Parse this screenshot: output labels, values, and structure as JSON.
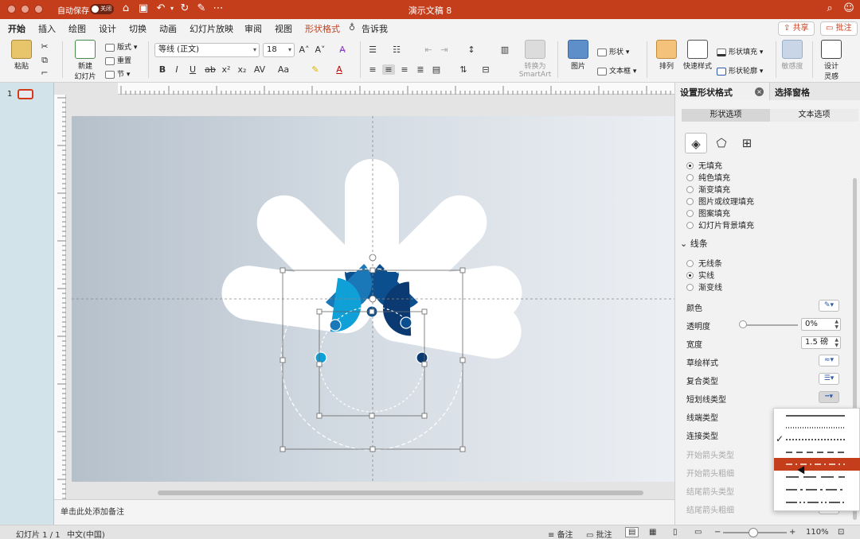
{
  "window": {
    "title": "演示文稿 8",
    "autosave_label": "自动保存",
    "autosave_state": "关闭"
  },
  "tabs": [
    "开始",
    "插入",
    "绘图",
    "设计",
    "切换",
    "动画",
    "幻灯片放映",
    "审阅",
    "视图",
    "形状格式",
    "告诉我"
  ],
  "active_tab": "开始",
  "top_buttons": {
    "share": "共享",
    "comment": "批注"
  },
  "ribbon": {
    "paste": "粘贴",
    "new_slide_line1": "新建",
    "new_slide_line2": "幻灯片",
    "layout": "版式",
    "reset": "重置",
    "section": "节",
    "font_name": "等线 (正文)",
    "font_size": "18",
    "convert_line1": "转换为",
    "convert_line2": "SmartArt",
    "picture": "图片",
    "shapes": "形状",
    "textbox": "文本框",
    "arrange": "排列",
    "quick_styles": "快速样式",
    "shape_fill": "形状填充",
    "shape_outline": "形状轮廓",
    "sensitivity": "敏感度",
    "designer_line1": "设计",
    "designer_line2": "灵感"
  },
  "slide_panel": {
    "number": "1"
  },
  "notes_placeholder": "单击此处添加备注",
  "status": {
    "slide": "幻灯片 1 / 1",
    "language": "中文(中国)",
    "notes": "备注",
    "comments": "批注",
    "zoom_level": "110%",
    "zoom_fraction": 0.45
  },
  "pane": {
    "title": "设置形状格式",
    "other_tab": "选择窗格",
    "subtab_shape": "形状选项",
    "subtab_text": "文本选项",
    "fill_options": [
      {
        "label": "无填充",
        "checked": true
      },
      {
        "label": "纯色填充",
        "checked": false
      },
      {
        "label": "渐变填充",
        "checked": false
      },
      {
        "label": "图片或纹理填充",
        "checked": false
      },
      {
        "label": "图案填充",
        "checked": false
      },
      {
        "label": "幻灯片背景填充",
        "checked": false
      }
    ],
    "line_section": "线条",
    "line_options": [
      {
        "label": "无线条",
        "checked": false
      },
      {
        "label": "实线",
        "checked": true
      },
      {
        "label": "渐变线",
        "checked": false
      }
    ],
    "props": {
      "color": "颜色",
      "transparency": "透明度",
      "transparency_value": "0%",
      "width": "宽度",
      "width_value": "1.5 磅",
      "sketch": "草绘样式",
      "compound": "复合类型",
      "dash": "短划线类型",
      "cap": "线端类型",
      "join": "连接类型",
      "begin_arrow_type": "开始箭头类型",
      "begin_arrow_size": "开始箭头粗细",
      "end_arrow_type": "结尾箭头类型",
      "end_arrow_size": "结尾箭头粗细"
    }
  },
  "dash_menu": {
    "styles": [
      "solid",
      "round-dot",
      "square-dot",
      "dash",
      "dash-dot",
      "long-dash",
      "long-dash-dot",
      "long-dash-dot-dot"
    ],
    "checked_index": 1,
    "hover_index": 4
  },
  "colors": {
    "accent": "#c43e1c",
    "blue_light": "#0fa0d8",
    "blue_mid": "#1a78b8",
    "blue_dark": "#0c4f8f",
    "blue_navy": "#0b3a73"
  }
}
